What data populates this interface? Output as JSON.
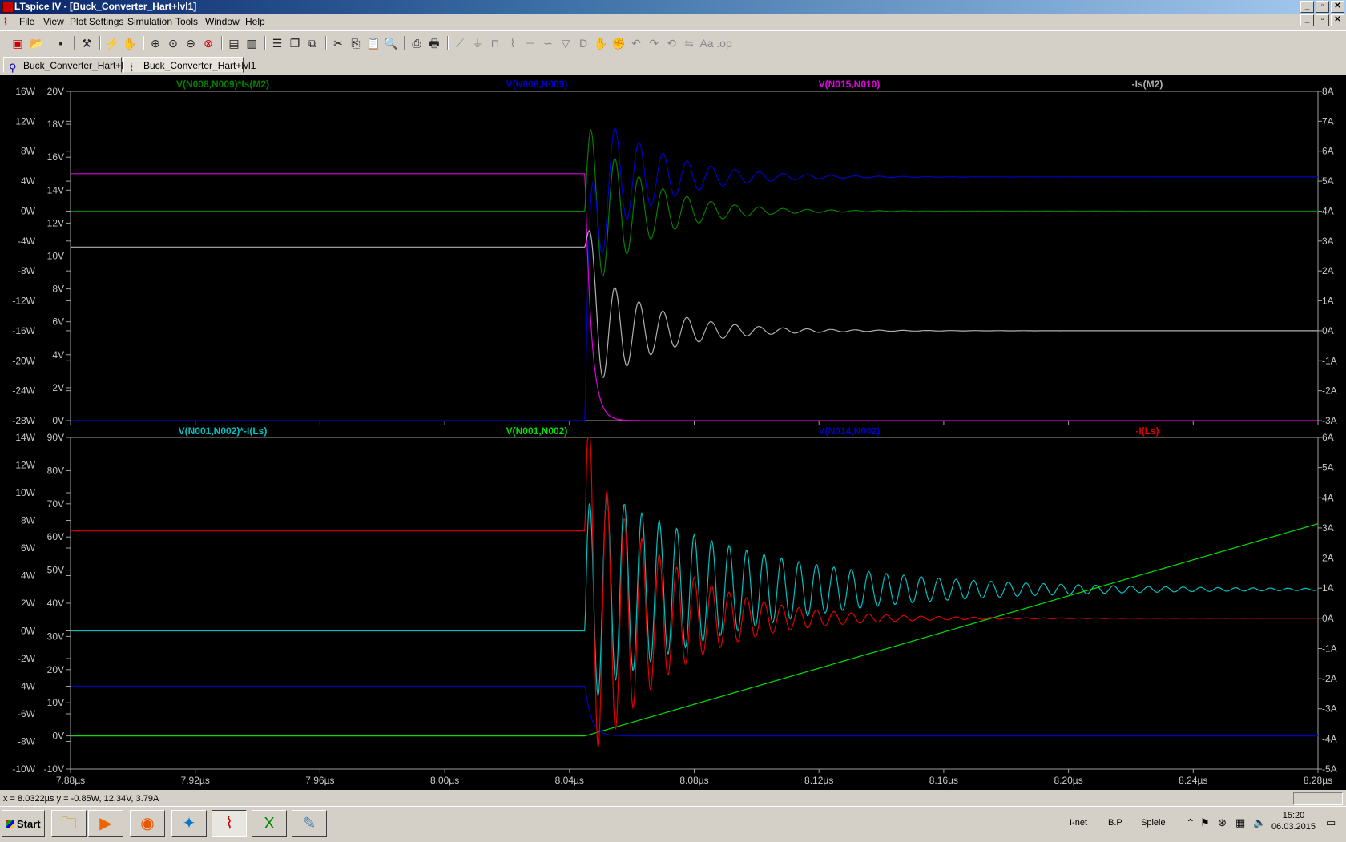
{
  "window": {
    "title": "LTspice IV - [Buck_Converter_Hart+lvl1]"
  },
  "menu": [
    "File",
    "View",
    "Plot Settings",
    "Simulation",
    "Tools",
    "Window",
    "Help"
  ],
  "tabs": [
    {
      "label": "Buck_Converter_Hart+lvl1",
      "icon": "schematic-icon"
    },
    {
      "label": "Buck_Converter_Hart+lvl1",
      "icon": "waveform-icon"
    }
  ],
  "status": {
    "cursor": "x = 8.0322µs    y = -0.85W, 12.34V, 3.79A"
  },
  "taskbar": {
    "start": "Start",
    "tray_labels": [
      "I-net",
      "B.P",
      "Spiele"
    ],
    "time": "15:20",
    "date": "06.03.2015"
  },
  "chart_data": [
    {
      "type": "line",
      "x_ticks": [
        "7.88µs",
        "7.92µs",
        "7.96µs",
        "8.00µs",
        "8.04µs",
        "8.08µs",
        "8.12µs",
        "8.16µs",
        "8.20µs",
        "8.24µs",
        "8.28µs"
      ],
      "xlim": [
        7.88,
        8.28
      ],
      "y_axes": {
        "power": {
          "ticks": [
            "16W",
            "12W",
            "8W",
            "4W",
            "0W",
            "-4W",
            "-8W",
            "-12W",
            "-16W",
            "-20W",
            "-24W",
            "-28W"
          ],
          "ylim": [
            -28,
            16
          ]
        },
        "voltage": {
          "ticks": [
            "20V",
            "18V",
            "16V",
            "14V",
            "12V",
            "10V",
            "8V",
            "6V",
            "4V",
            "2V",
            "0V"
          ],
          "ylim": [
            0,
            20
          ]
        },
        "current": {
          "ticks": [
            "8A",
            "7A",
            "6A",
            "5A",
            "4A",
            "3A",
            "2A",
            "1A",
            "0A",
            "-1A",
            "-2A",
            "-3A"
          ],
          "ylim": [
            -3,
            8
          ]
        }
      },
      "series": [
        {
          "name": "V(N008,N009)*Is(M2)",
          "color": "#008000",
          "axis": "power",
          "level_before": 0,
          "level_after": 0,
          "ring_amp": 12,
          "decay": 0.018,
          "period": 0.0077
        },
        {
          "name": "V(N008,N009)",
          "color": "#0000c8",
          "axis": "voltage",
          "level_before": 0,
          "level_after": 14.8,
          "ring_amp": 5,
          "decay": 0.02,
          "period": 0.0077
        },
        {
          "name": "V(N015,N010)",
          "color": "#e000e0",
          "axis": "voltage",
          "level_before": 15,
          "level_after": 0,
          "ring_amp": 0,
          "decay": 0.02,
          "period": 0.0077
        },
        {
          "name": "-Is(M2)",
          "color": "#b0b0b0",
          "axis": "current",
          "level_before": 2.8,
          "level_after": 0,
          "ring_amp": 2.3,
          "decay": 0.02,
          "period": 0.0077
        }
      ]
    },
    {
      "type": "line",
      "x_ticks": [
        "7.88µs",
        "7.92µs",
        "7.96µs",
        "8.00µs",
        "8.04µs",
        "8.08µs",
        "8.12µs",
        "8.16µs",
        "8.20µs",
        "8.24µs",
        "8.28µs"
      ],
      "xlim": [
        7.88,
        8.28
      ],
      "y_axes": {
        "power": {
          "ticks": [
            "14W",
            "12W",
            "10W",
            "8W",
            "6W",
            "4W",
            "2W",
            "0W",
            "-2W",
            "-4W",
            "-6W",
            "-8W",
            "-10W"
          ],
          "ylim": [
            -10,
            14
          ]
        },
        "voltage": {
          "ticks": [
            "90V",
            "80V",
            "70V",
            "60V",
            "50V",
            "40V",
            "30V",
            "20V",
            "10V",
            "0V",
            "-10V"
          ],
          "ylim": [
            -10,
            90
          ]
        },
        "current": {
          "ticks": [
            "6A",
            "5A",
            "4A",
            "3A",
            "2A",
            "1A",
            "0A",
            "-1A",
            "-2A",
            "-3A",
            "-4A",
            "-5A"
          ],
          "ylim": [
            -5,
            6
          ]
        }
      },
      "series": [
        {
          "name": "V(N001,N002)*-I(Ls)",
          "color": "#00c0c0",
          "axis": "power",
          "level_before": 0,
          "level_after": 3,
          "ring_amp": 8,
          "decay": 0.05,
          "period": 0.0056
        },
        {
          "name": "V(N001,N002)",
          "color": "#00e000",
          "axis": "voltage",
          "level_before": 0,
          "level_after": 64,
          "ring_amp": 0,
          "decay": 0.05,
          "period": 0.0056
        },
        {
          "name": "V(N014,N002)",
          "color": "#0000c8",
          "axis": "voltage",
          "level_before": 15,
          "level_after": 0,
          "ring_amp": 0,
          "decay": 0.05,
          "period": 0.0056
        },
        {
          "name": "-I(Ls)",
          "color": "#e00000",
          "axis": "current",
          "level_before": 2.9,
          "level_after": 0,
          "ring_amp": 5.5,
          "decay": 0.025,
          "period": 0.0056
        }
      ]
    }
  ]
}
